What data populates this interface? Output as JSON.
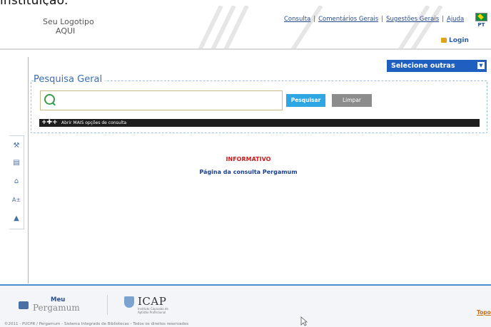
{
  "caption": "instituição.",
  "header": {
    "logo_line1": "Seu Logotipo",
    "logo_line2": "AQUI",
    "nav": [
      {
        "label": "Consulta"
      },
      {
        "label": "Comentários Gerais"
      },
      {
        "label": "Sugestões Gerais"
      },
      {
        "label": "Ajuda"
      }
    ],
    "nav_separator": "|",
    "language": "PT",
    "login_label": "Login"
  },
  "search": {
    "select_other_label": "Selecione outras Pesquisas",
    "select_other_icon": "chevron-down-icon",
    "legend": "Pesquisa Geral",
    "input_value": "",
    "search_button": "Pesquisar",
    "clear_button": "Limpar",
    "more_options_label": "Abrir MAIS opções de consulta"
  },
  "sidebar": {
    "icons": [
      "tools-icon",
      "bookmark-icon",
      "home-icon",
      "font-size-icon",
      "up-arrow-icon"
    ]
  },
  "main": {
    "informativo": "INFORMATIVO",
    "consulta_text": "Página da consulta Pergamum"
  },
  "footer": {
    "meu": "Meu",
    "pergamum": "Pergamum",
    "icap": "ICAP",
    "icap_sub": "Instituto Capixaba de Aptidão Profissional",
    "topo": "Topo",
    "copyright": "©2011 - PUCPR / Pergamum - Sistema Integrado de Bibliotecas - Todos os direitos reservados"
  },
  "colors": {
    "primary_blue": "#1f5fbf",
    "search_button": "#2da6e3",
    "clear_button": "#8c8c8c",
    "informativo": "#d01a1a",
    "link": "#2a4d8f"
  }
}
